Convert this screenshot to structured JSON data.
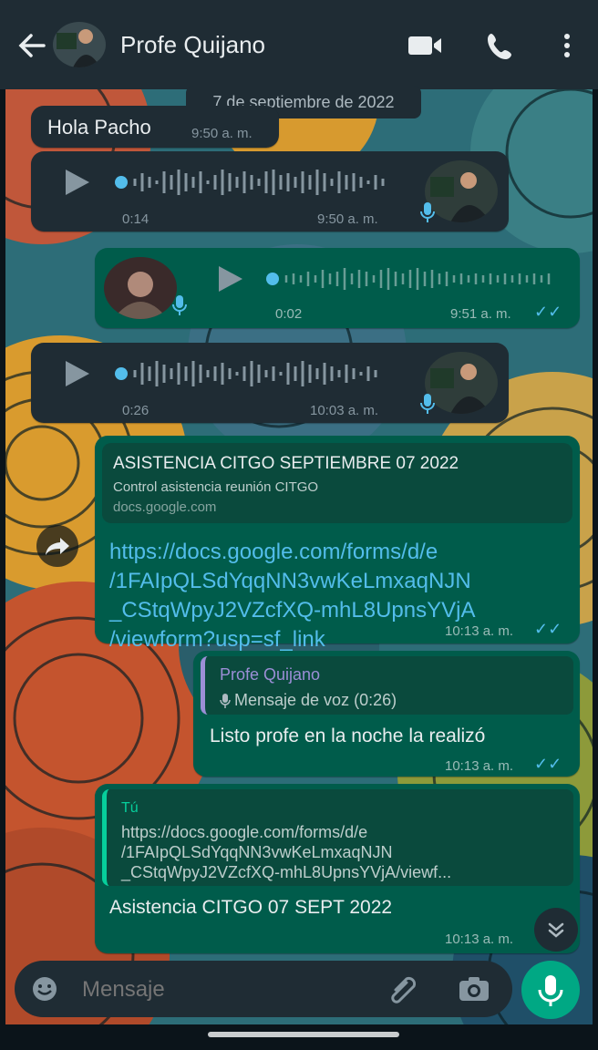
{
  "header": {
    "contact_name": "Profe Quijano"
  },
  "date_chip": "7 de septiembre de 2022",
  "messages": {
    "greeting": {
      "text": "Hola Pacho",
      "time": "9:50 a. m."
    },
    "voice1": {
      "duration": "0:14",
      "time": "9:50 a. m."
    },
    "voice2": {
      "duration": "0:02",
      "time": "9:51 a. m."
    },
    "voice3": {
      "duration": "0:26",
      "time": "10:03 a. m."
    },
    "link_msg": {
      "preview_title": "ASISTENCIA CITGO SEPTIEMBRE 07 2022",
      "preview_desc": "Control asistencia reunión CITGO",
      "preview_domain": "docs.google.com",
      "link_line1": "https://docs.google.com/forms/d/e",
      "link_line2": "/1FAIpQLSdYqqNN3vwKeLmxaqNJN",
      "link_line3": "_CStqWpyJ2VZcfXQ-mhL8UpnsYVjA",
      "link_line4": "/viewform?usp=sf_link",
      "time": "10:13 a. m."
    },
    "reply1": {
      "quote_author": "Profe Quijano",
      "quote_text": "Mensaje de voz (0:26)",
      "text": "Listo profe en la noche la realizó",
      "time": "10:13 a. m."
    },
    "reply2": {
      "quote_author": "Tú",
      "quote_line1": "https://docs.google.com/forms/d/e",
      "quote_line2": "/1FAIpQLSdYqqNN3vwKeLmxaqNJN",
      "quote_line3": "_CStqWpyJ2VZcfXQ-mhL8UpnsYVjA/viewf...",
      "text": "Asistencia CITGO 07 SEPT 2022",
      "time": "10:13 a. m."
    }
  },
  "input": {
    "placeholder": "Mensaje"
  },
  "colors": {
    "header": "#1f2c34",
    "incoming": "#1f2c34",
    "outgoing": "#005c4b",
    "accent": "#00a884",
    "link": "#53bdeb"
  }
}
